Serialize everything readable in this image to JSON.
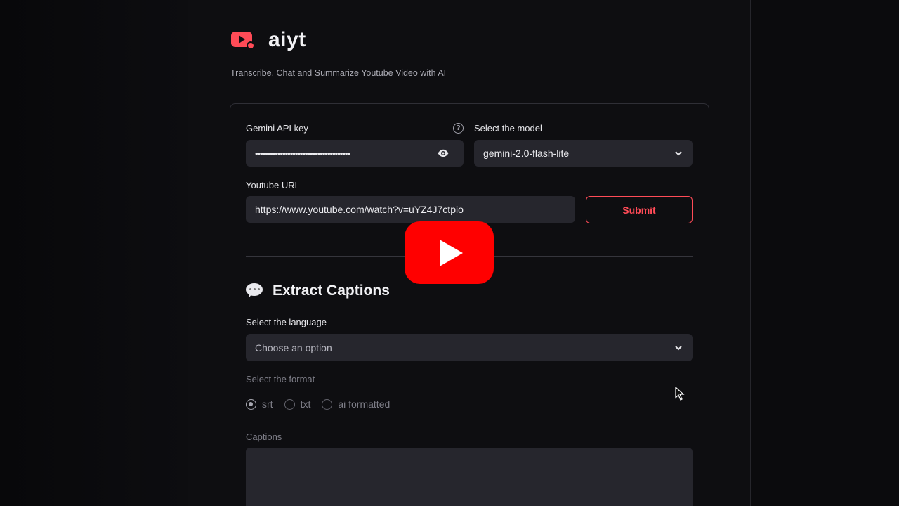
{
  "app": {
    "title": "aiyt",
    "tagline": "Transcribe, Chat and Summarize Youtube Video with AI"
  },
  "form": {
    "api_key_label": "Gemini API key",
    "api_key_value": "••••••••••••••••••••••••••••••••••••••",
    "model_label": "Select the model",
    "model_value": "gemini-2.0-flash-lite",
    "url_label": "Youtube URL",
    "url_value": "https://www.youtube.com/watch?v=uYZ4J7ctpio",
    "submit_label": "Submit"
  },
  "captions_section": {
    "title": "Extract Captions",
    "language_label": "Select the language",
    "language_placeholder": "Choose an option",
    "format_label": "Select the format",
    "formats": [
      {
        "label": "srt",
        "selected": true
      },
      {
        "label": "txt",
        "selected": false
      },
      {
        "label": "ai formatted",
        "selected": false
      }
    ],
    "captions_label": "Captions"
  },
  "icons": {
    "logo": "youtube-plus-icon",
    "help": "question-circle-icon",
    "eye": "eye-icon",
    "chevron": "chevron-down-icon",
    "speech": "speech-bubble-icon",
    "overlay": "youtube-play-icon"
  },
  "colors": {
    "accent": "#ff4b57",
    "background": "#0e0e11",
    "field": "#26262d",
    "youtube_red": "#ff0000"
  }
}
